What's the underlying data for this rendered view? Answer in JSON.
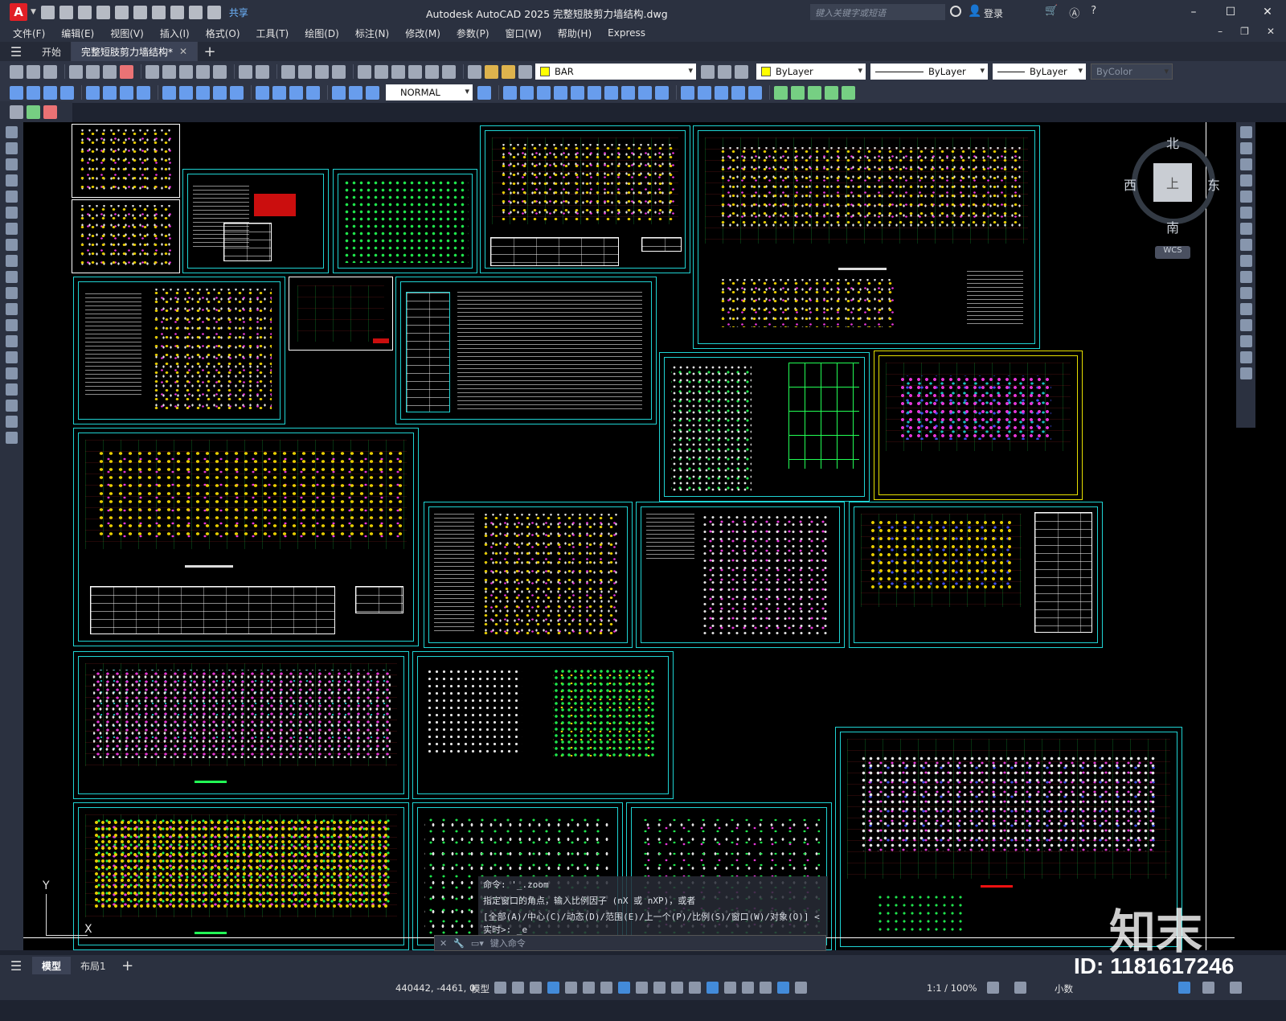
{
  "titlebar": {
    "app_logo": "A",
    "share": "共享",
    "title": "Autodesk AutoCAD 2025    完整短肢剪力墙结构.dwg",
    "search_placeholder": "键入关键字或短语",
    "login": "登录",
    "icons": [
      "new-icon",
      "open-icon",
      "save-icon",
      "saveas-icon",
      "plot-icon",
      "undo-icon",
      "redo-icon"
    ]
  },
  "menubar": {
    "items": [
      "文件(F)",
      "编辑(E)",
      "视图(V)",
      "插入(I)",
      "格式(O)",
      "工具(T)",
      "绘图(D)",
      "标注(N)",
      "修改(M)",
      "参数(P)",
      "窗口(W)",
      "帮助(H)",
      "Express"
    ]
  },
  "tabs": {
    "start": "开始",
    "active_file": "完整短肢剪力墙结构*"
  },
  "toolbar": {
    "layer": "BAR",
    "text_style": "NORMAL",
    "color": "ByLayer",
    "linetype": "ByLayer",
    "lineweight": "ByLayer",
    "plotstyle": "ByColor",
    "layer_color": "#ffff00"
  },
  "viewcube": {
    "north": "北",
    "south": "南",
    "east": "东",
    "west": "西",
    "top": "上",
    "wcs": "WCS"
  },
  "ucs": {
    "x": "X",
    "y": "Y"
  },
  "command": {
    "lines": [
      "命令:  '_.zoom",
      "指定窗口的角点，输入比例因子 (nX 或 nXP)，或者",
      "[全部(A)/中心(C)/动态(D)/范围(E)/上一个(P)/比例(S)/窗口(W)/对象(O)] <实时>:  _e"
    ],
    "placeholder": "键入命令"
  },
  "layout_tabs": {
    "model": "模型",
    "layout1": "布局1"
  },
  "status": {
    "coords": "440442, -4461, 0",
    "model": "模型",
    "scale": "1:1 / 100%",
    "units": "小数"
  },
  "watermark": {
    "logo": "知末",
    "id": "ID: 1181617246"
  },
  "colors": {
    "frame": "#1fd3d3",
    "frame_highlight": "#e6e000",
    "canvas": "#000000",
    "ui": "#2b3140"
  }
}
